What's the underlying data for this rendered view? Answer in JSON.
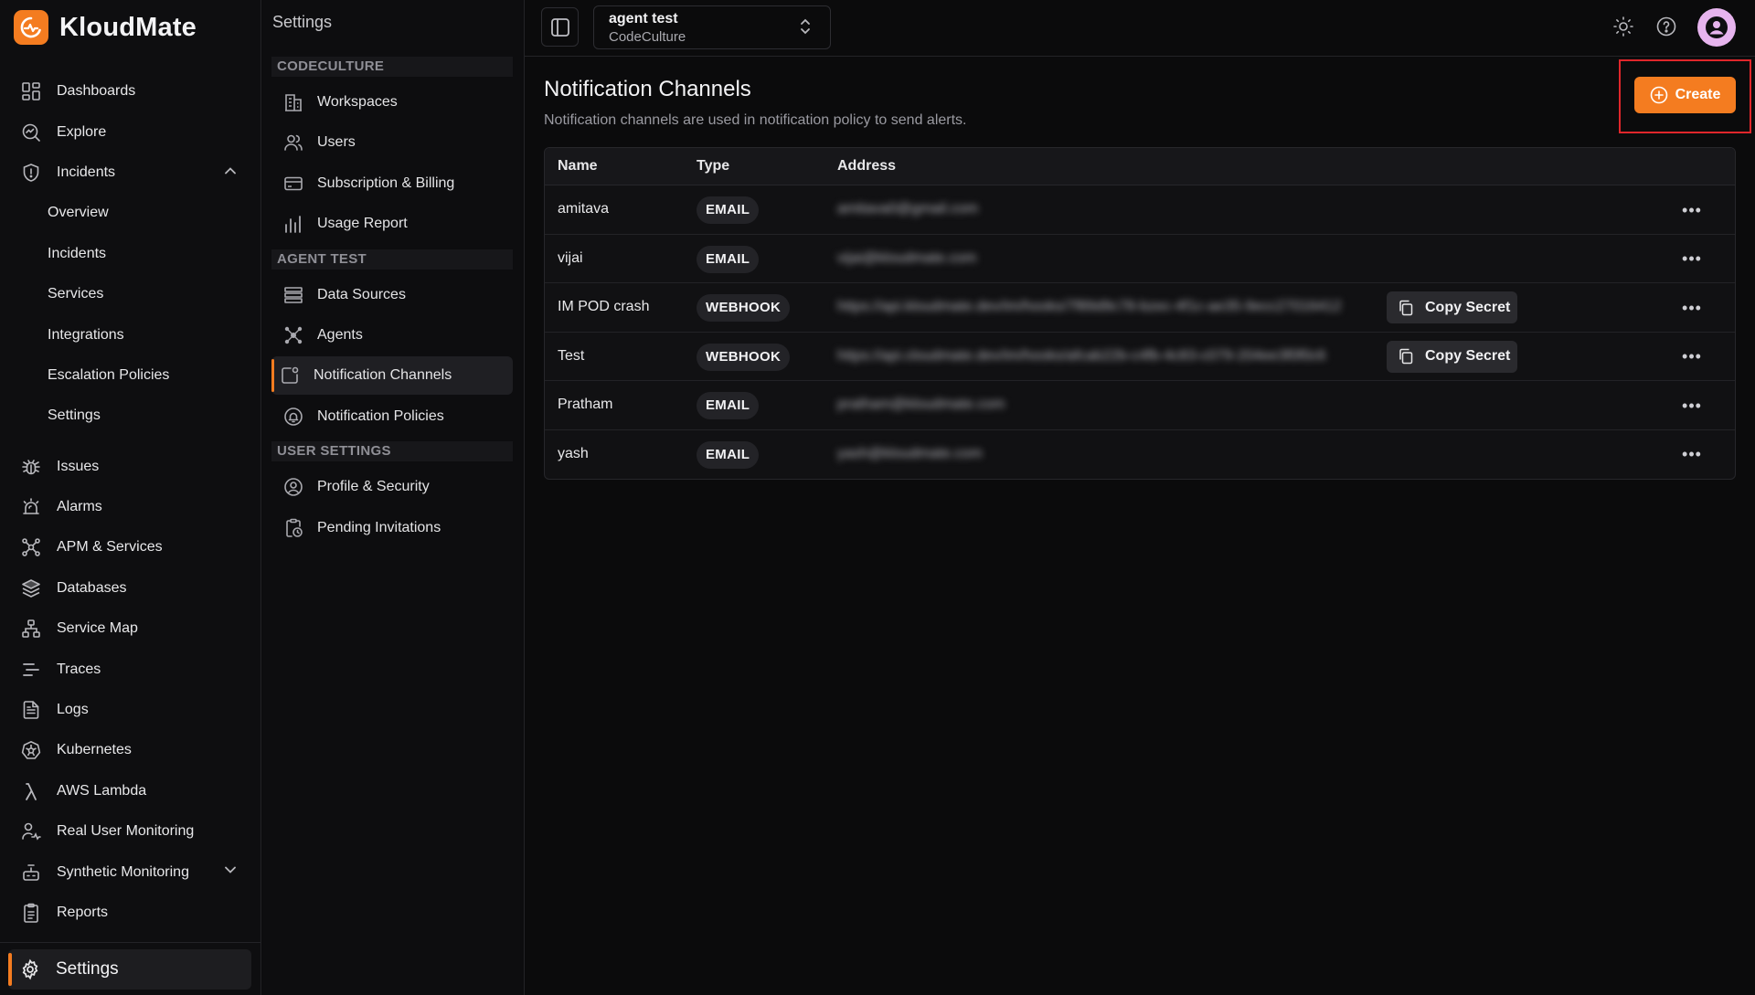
{
  "app": {
    "name": "KloudMate"
  },
  "nav": {
    "items": [
      {
        "label": "Dashboards",
        "icon": "dashboard-icon"
      },
      {
        "label": "Explore",
        "icon": "explore-icon"
      },
      {
        "label": "Incidents",
        "icon": "shield-icon",
        "expanded": true
      }
    ],
    "incident_sub": [
      "Overview",
      "Incidents",
      "Services",
      "Integrations",
      "Escalation Policies",
      "Settings"
    ],
    "items2": [
      {
        "label": "Issues",
        "icon": "bug-icon"
      },
      {
        "label": "Alarms",
        "icon": "alarm-icon"
      },
      {
        "label": "APM & Services",
        "icon": "apm-icon"
      },
      {
        "label": "Databases",
        "icon": "database-icon"
      },
      {
        "label": "Service Map",
        "icon": "service-map-icon"
      },
      {
        "label": "Traces",
        "icon": "traces-icon"
      },
      {
        "label": "Logs",
        "icon": "logs-icon"
      },
      {
        "label": "Kubernetes",
        "icon": "kubernetes-icon"
      },
      {
        "label": "AWS Lambda",
        "icon": "lambda-icon"
      },
      {
        "label": "Real User Monitoring",
        "icon": "rum-icon"
      },
      {
        "label": "Synthetic Monitoring",
        "icon": "synthetic-icon"
      },
      {
        "label": "Reports",
        "icon": "reports-icon"
      }
    ],
    "settings_label": "Settings"
  },
  "settings_nav": {
    "title": "Settings",
    "sections": [
      {
        "label": "CODECULTURE",
        "items": [
          "Workspaces",
          "Users",
          "Subscription & Billing",
          "Usage Report"
        ]
      },
      {
        "label": "AGENT TEST",
        "items": [
          "Data Sources",
          "Agents",
          "Notification Channels",
          "Notification Policies"
        ]
      },
      {
        "label": "USER SETTINGS",
        "items": [
          "Profile & Security",
          "Pending Invitations"
        ]
      }
    ],
    "active": "Notification Channels"
  },
  "topbar": {
    "workspace_name": "agent test",
    "workspace_org": "CodeCulture"
  },
  "main": {
    "title": "Notification Channels",
    "subtitle": "Notification channels are used in notification policy to send alerts.",
    "create_label": "Create",
    "columns": [
      "Name",
      "Type",
      "Address"
    ],
    "rows": [
      {
        "name": "amitava",
        "type": "EMAIL",
        "address": "amitava0@gmail.com",
        "copy": false
      },
      {
        "name": "vijai",
        "type": "EMAIL",
        "address": "vijai@kloudmate.com",
        "copy": false
      },
      {
        "name": "IM POD crash",
        "type": "WEBHOOK",
        "address": "https://api.kloudmate.dev/im/hooks/7f89d9c78-bzec-4f1c-ae35-9ecc27016412",
        "copy": true
      },
      {
        "name": "Test",
        "type": "WEBHOOK",
        "address": "https://api.cloudmate.dev/im/hooks/afcab22b-c4fb-4c83-c079-204ee3f0f0c6",
        "copy": true
      },
      {
        "name": "Pratham",
        "type": "EMAIL",
        "address": "pratham@kloudmate.com",
        "copy": false
      },
      {
        "name": "yash",
        "type": "EMAIL",
        "address": "yash@kloudmate.com",
        "copy": false
      }
    ],
    "copy_label": "Copy Secret"
  },
  "colors": {
    "accent": "#f47c20",
    "highlight": "#e0262b",
    "background": "#0b0b0c"
  }
}
